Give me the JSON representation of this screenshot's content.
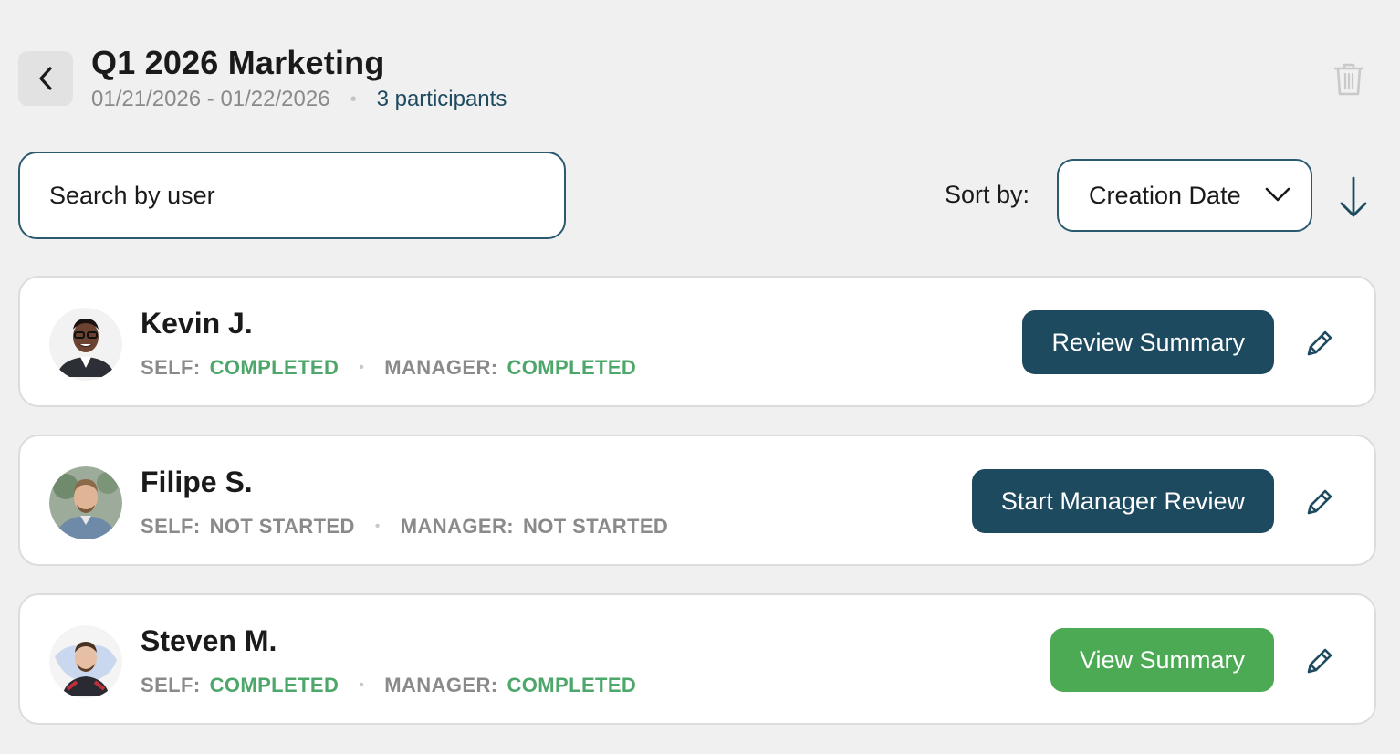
{
  "header": {
    "title": "Q1 2026 Marketing",
    "date_range": "01/21/2026 - 01/22/2026",
    "separator": "•",
    "participants": "3 participants"
  },
  "search": {
    "placeholder": "Search by user",
    "value": ""
  },
  "sort": {
    "label": "Sort by:",
    "selected": "Creation Date",
    "direction": "descending"
  },
  "labels": {
    "self": "SELF:",
    "manager": "MANAGER:"
  },
  "participants": [
    {
      "name": "Kevin J.",
      "self_status": "COMPLETED",
      "manager_status": "COMPLETED",
      "action": "Review Summary",
      "action_style": "dark"
    },
    {
      "name": "Filipe S.",
      "self_status": "NOT STARTED",
      "manager_status": "NOT STARTED",
      "action": "Start Manager Review",
      "action_style": "dark"
    },
    {
      "name": "Steven M.",
      "self_status": "COMPLETED",
      "manager_status": "COMPLETED",
      "action": "View Summary",
      "action_style": "green"
    }
  ],
  "colors": {
    "primary": "#1e4a5f",
    "success": "#4caa55",
    "completed_text": "#4ea76a",
    "muted_text": "#8a8a8a"
  }
}
